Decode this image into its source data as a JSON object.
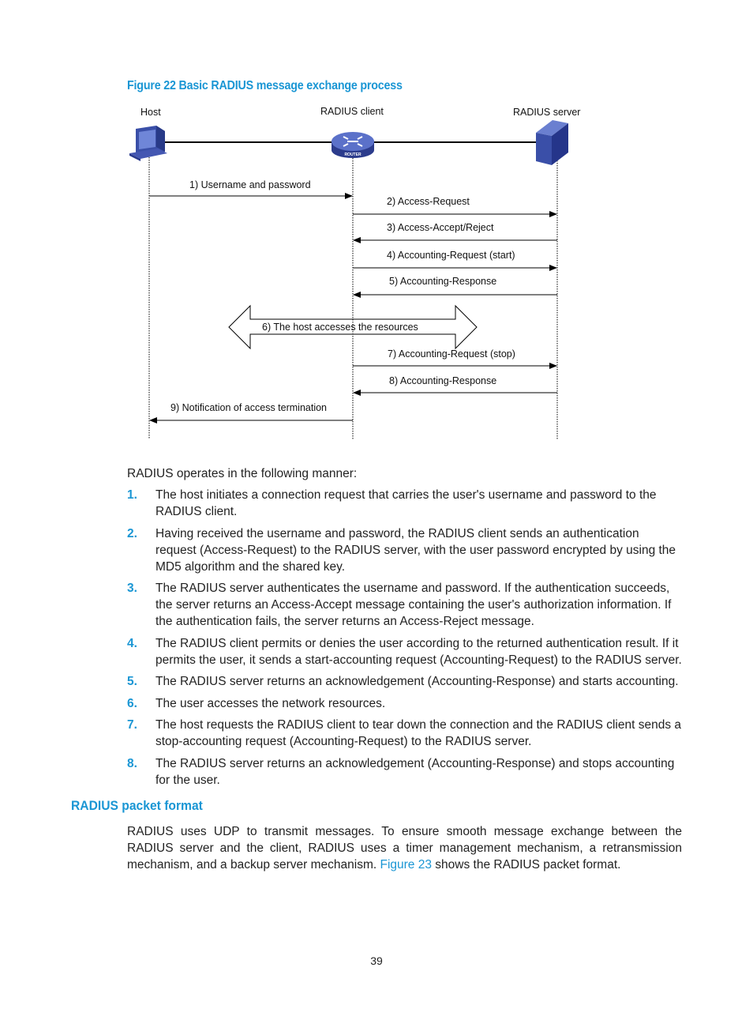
{
  "figure": {
    "caption": "Figure 22 Basic RADIUS message exchange process",
    "nodes": {
      "host": "Host",
      "client": "RADIUS client",
      "server": "RADIUS server",
      "router_badge": "ROUTER"
    },
    "messages": [
      {
        "label": "1) Username and password",
        "from": "host",
        "to": "client"
      },
      {
        "label": "2) Access-Request",
        "from": "client",
        "to": "server"
      },
      {
        "label": "3) Access-Accept/Reject",
        "from": "server",
        "to": "client"
      },
      {
        "label": "4) Accounting-Request (start)",
        "from": "client",
        "to": "server"
      },
      {
        "label": "5) Accounting-Response",
        "from": "server",
        "to": "client"
      },
      {
        "label": "6) The host accesses the resources",
        "from": "host",
        "to": "server",
        "style": "double-arrow"
      },
      {
        "label": "7) Accounting-Request (stop)",
        "from": "client",
        "to": "server"
      },
      {
        "label": "8) Accounting-Response",
        "from": "server",
        "to": "client"
      },
      {
        "label": "9) Notification of access termination",
        "from": "client",
        "to": "host"
      }
    ]
  },
  "intro": "RADIUS operates in the following manner:",
  "steps": [
    {
      "num": "1.",
      "text": "The host initiates a connection request that carries the user's username and password to the RADIUS client."
    },
    {
      "num": "2.",
      "text": "Having received the username and password, the RADIUS client sends an authentication request (Access-Request) to the RADIUS server, with the user password encrypted by using the MD5 algorithm and the shared key."
    },
    {
      "num": "3.",
      "text": "The RADIUS server authenticates the username and password. If the authentication succeeds, the server returns an Access-Accept message containing the user's authorization information. If the authentication fails, the server returns an Access-Reject message."
    },
    {
      "num": "4.",
      "text": "The RADIUS client permits or denies the user according to the returned authentication result. If it permits the user, it sends a start-accounting request (Accounting-Request) to the RADIUS server."
    },
    {
      "num": "5.",
      "text": "The RADIUS server returns an acknowledgement (Accounting-Response) and starts accounting."
    },
    {
      "num": "6.",
      "text": "The user accesses the network resources."
    },
    {
      "num": "7.",
      "text": "The host requests the RADIUS client to tear down the connection and the RADIUS client sends a stop-accounting request (Accounting-Request) to the RADIUS server."
    },
    {
      "num": "8.",
      "text": "The RADIUS server returns an acknowledgement (Accounting-Response) and stops accounting for the user."
    }
  ],
  "section": {
    "heading": "RADIUS packet format",
    "para_before": "RADIUS uses UDP to transmit messages. To ensure smooth message exchange between the RADIUS server and the client, RADIUS uses a timer management mechanism, a retransmission mechanism, and a backup server mechanism. ",
    "link": "Figure 23",
    "para_after": " shows the RADIUS packet format."
  },
  "colors": {
    "accent": "#1a96d4",
    "device_blue": "#3a4fa8"
  },
  "page_number": "39"
}
